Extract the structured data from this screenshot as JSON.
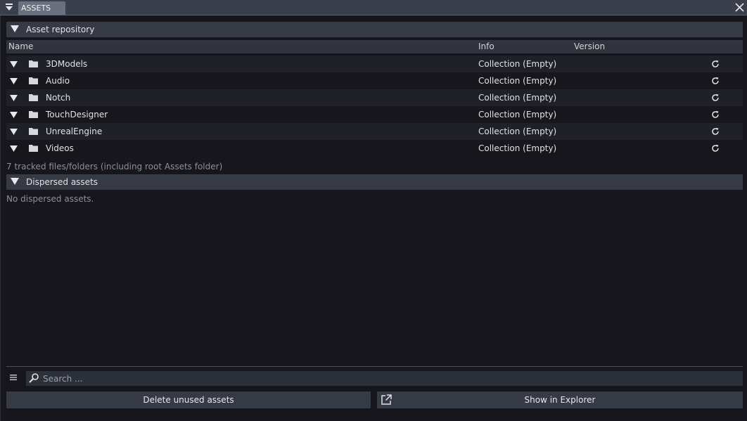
{
  "panel": {
    "tab_label": "ASSETS"
  },
  "repository": {
    "header": "Asset repository",
    "columns": {
      "name": "Name",
      "info": "Info",
      "version": "Version"
    },
    "rows": [
      {
        "name": "3DModels",
        "info": "Collection (Empty)"
      },
      {
        "name": "Audio",
        "info": "Collection (Empty)"
      },
      {
        "name": "Notch",
        "info": "Collection (Empty)"
      },
      {
        "name": "TouchDesigner",
        "info": "Collection (Empty)"
      },
      {
        "name": "UnrealEngine",
        "info": "Collection (Empty)"
      },
      {
        "name": "Videos",
        "info": "Collection (Empty)"
      }
    ],
    "footer": "7 tracked files/folders (including root Assets folder)"
  },
  "dispersed": {
    "header": "Dispersed assets",
    "empty_text": "No dispersed assets."
  },
  "search": {
    "placeholder": "Search ..."
  },
  "buttons": {
    "delete_unused": "Delete unused assets",
    "show_in_explorer": "Show in Explorer"
  },
  "icons": {
    "panel_menu": "triangle-down-icon",
    "close": "close-icon",
    "expand": "triangle-down-icon",
    "folder": "folder-icon",
    "sync": "refresh-icon",
    "list_menu": "menu-icon",
    "search": "search-icon",
    "external": "external-link-icon"
  },
  "colors": {
    "background": "#16161c",
    "header": "#353a45",
    "tab": "#6a7080",
    "text": "#d4d6dc",
    "muted": "#8c909a"
  }
}
